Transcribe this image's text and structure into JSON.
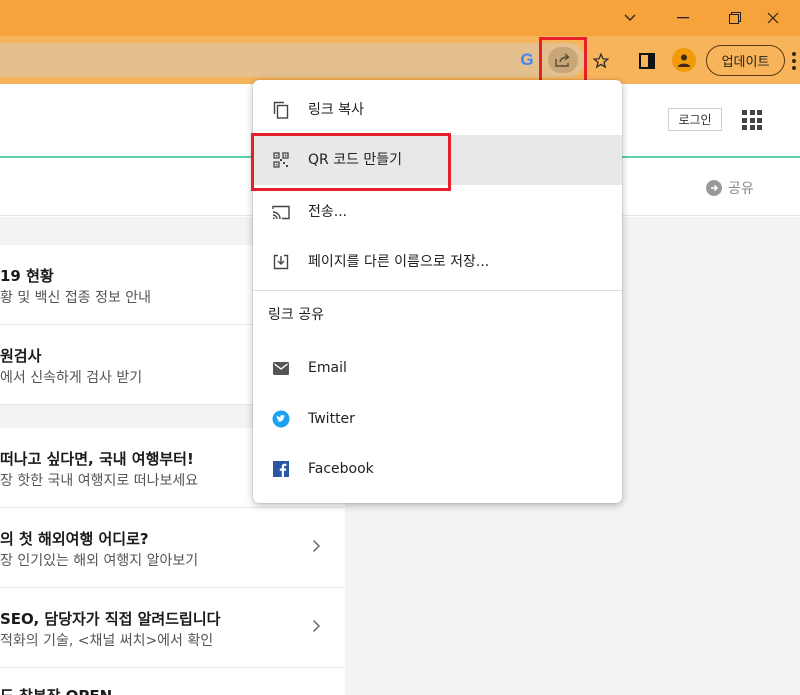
{
  "window": {
    "controls": {
      "minimize": "⌄",
      "maximize": "❐",
      "close": "✕"
    }
  },
  "toolbar": {
    "google_logo": "G",
    "update_label": "업데이트",
    "icons": [
      "google-icon",
      "share-icon",
      "star-icon",
      "side-panel-icon",
      "profile-icon",
      "kebab-menu-icon"
    ]
  },
  "header": {
    "login_label": "로그인",
    "share_label": "공유"
  },
  "list": {
    "items": [
      {
        "title": "19 현황",
        "subtitle": "황 및 백신 접종 정보 안내",
        "chevron": false
      },
      {
        "title": "원검사",
        "subtitle": "에서 신속하게 검사 받기",
        "chevron": false
      },
      {
        "title": "떠나고 싶다면, 국내 여행부터!",
        "subtitle": "장 핫한 국내 여행지로 떠나보세요",
        "chevron": false
      },
      {
        "title": "의 첫 해외여행 어디로?",
        "subtitle": "장 인기있는 해외 여행지 알아보기",
        "chevron": true
      },
      {
        "title": "SEO, 담당자가 직접 알려드립니다",
        "subtitle": "적화의 기술, <채널 써치>에서 확인",
        "chevron": true
      },
      {
        "title": "도 참본장 OPEN",
        "subtitle": "",
        "chevron": false
      }
    ]
  },
  "share_menu": {
    "items": [
      {
        "label": "링크 복사",
        "icon": "copy-icon"
      },
      {
        "label": "QR 코드 만들기",
        "icon": "qr-code-icon"
      },
      {
        "label": "전송...",
        "icon": "cast-icon"
      },
      {
        "label": "페이지를 다른 이름으로 저장...",
        "icon": "save-page-icon"
      }
    ],
    "section_title": "링크 공유",
    "social": [
      {
        "label": "Email",
        "icon": "email-icon"
      },
      {
        "label": "Twitter",
        "icon": "twitter-icon"
      },
      {
        "label": "Facebook",
        "icon": "facebook-icon"
      }
    ]
  },
  "colors": {
    "titlebar": "#f6a33b",
    "toolbar": "#f8b45a",
    "highlight_box": "#e5202b",
    "accent_line": "#5fd0a5",
    "twitter": "#1da1f2",
    "facebook": "#1877f2"
  }
}
